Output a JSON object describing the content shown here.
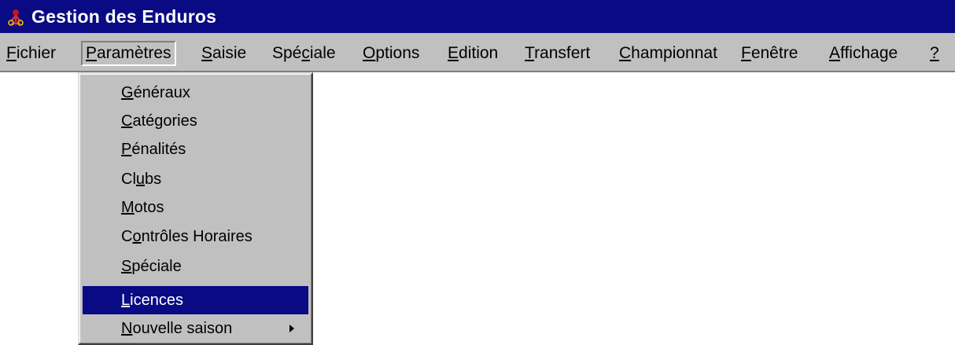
{
  "window": {
    "title": "Gestion des Enduros",
    "title_bar_color": "#0a0a84",
    "icon": "enduro-app-icon"
  },
  "menubar": {
    "items": [
      {
        "key": "F",
        "rest": "ichier"
      },
      {
        "key": "P",
        "rest": "aramètres",
        "active": true
      },
      {
        "key": "S",
        "rest": "aisie"
      },
      {
        "pre": "Spé",
        "key": "c",
        "rest": "iale"
      },
      {
        "key": "O",
        "rest": "ptions"
      },
      {
        "key": "E",
        "rest": "dition"
      },
      {
        "key": "T",
        "rest": "ransfert"
      },
      {
        "key": "C",
        "rest": "hampionnat"
      },
      {
        "key": "F",
        "rest": "enêtre"
      },
      {
        "key": "A",
        "rest": "ffichage"
      },
      {
        "key": "?",
        "rest": ""
      }
    ]
  },
  "dropdown": {
    "highlight_color": "#0a0a84",
    "items": [
      {
        "pre": "",
        "key": "G",
        "rest": "énéraux"
      },
      {
        "pre": "",
        "key": "C",
        "rest": "atégories"
      },
      {
        "pre": "",
        "key": "P",
        "rest": "énalités"
      },
      {
        "pre": "Cl",
        "key": "u",
        "rest": "bs"
      },
      {
        "pre": "",
        "key": "M",
        "rest": "otos"
      },
      {
        "pre": "C",
        "key": "o",
        "rest": "ntrôles Horaires"
      },
      {
        "pre": "",
        "key": "S",
        "rest": "péciale"
      },
      {
        "pre": "",
        "key": "L",
        "rest": "icences",
        "highlighted": true
      },
      {
        "pre": "",
        "key": "N",
        "rest": "ouvelle saison",
        "submenu": true
      }
    ]
  }
}
